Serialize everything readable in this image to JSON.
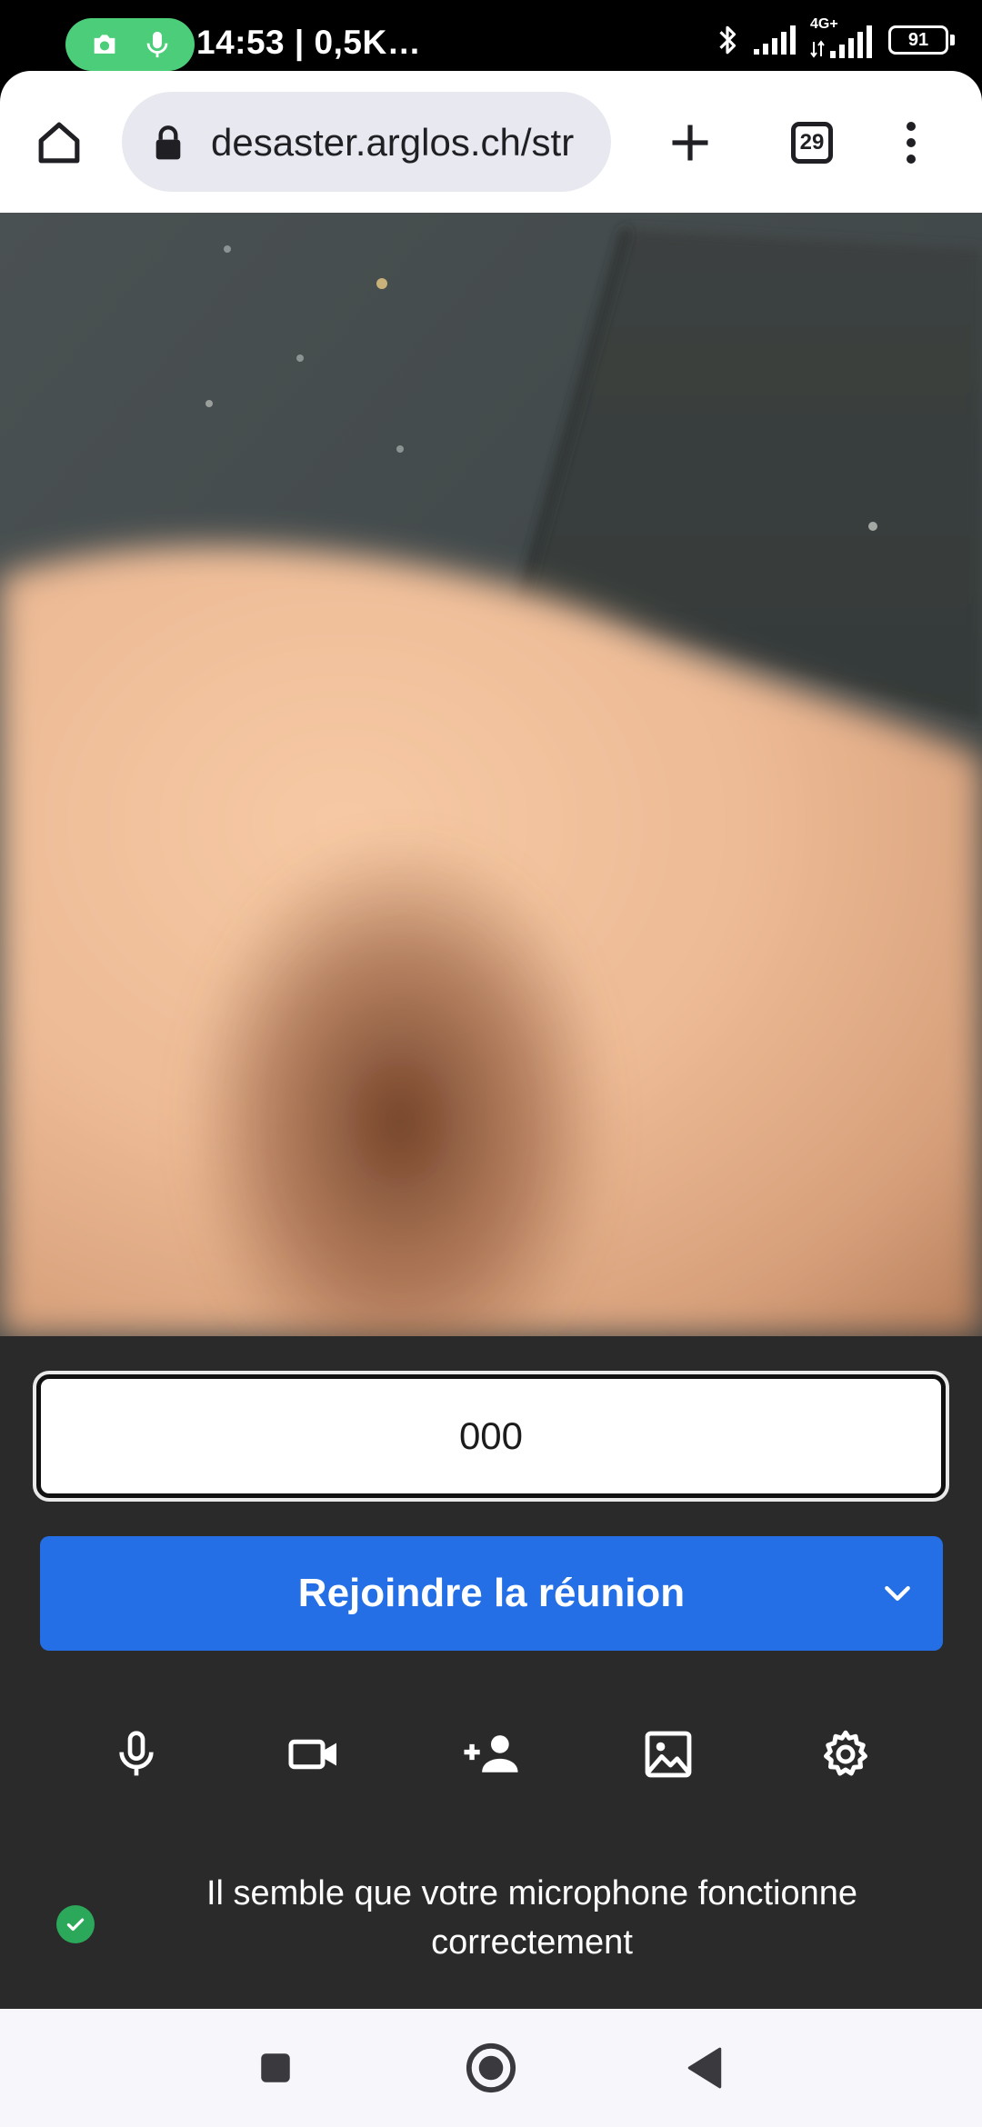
{
  "status_bar": {
    "time_text": "14:53 | 0,5K…",
    "network_label": "4G+",
    "battery_level": "91",
    "recording_icons": [
      "camera-icon",
      "microphone-icon"
    ],
    "pill_color": "#4ccd7a"
  },
  "browser": {
    "url": "desaster.arglos.ch/str",
    "tab_count": "29",
    "icons": [
      "home-icon",
      "lock-icon",
      "new-tab-icon",
      "tab-switcher-icon",
      "more-menu-icon"
    ]
  },
  "meeting": {
    "name_input_value": "000",
    "join_button_label": "Rejoindre la réunion",
    "join_button_color": "#246fe5",
    "toolbar_icons": [
      "microphone-icon",
      "camera-icon",
      "invite-person-icon",
      "background-image-icon",
      "settings-gear-icon"
    ],
    "mic_status_text": "Il semble que votre microphone fonctionne correctement",
    "status_color": "#2ba859"
  },
  "navbar": {
    "icons": [
      "recents-square-icon",
      "home-circle-icon",
      "back-triangle-icon"
    ]
  }
}
